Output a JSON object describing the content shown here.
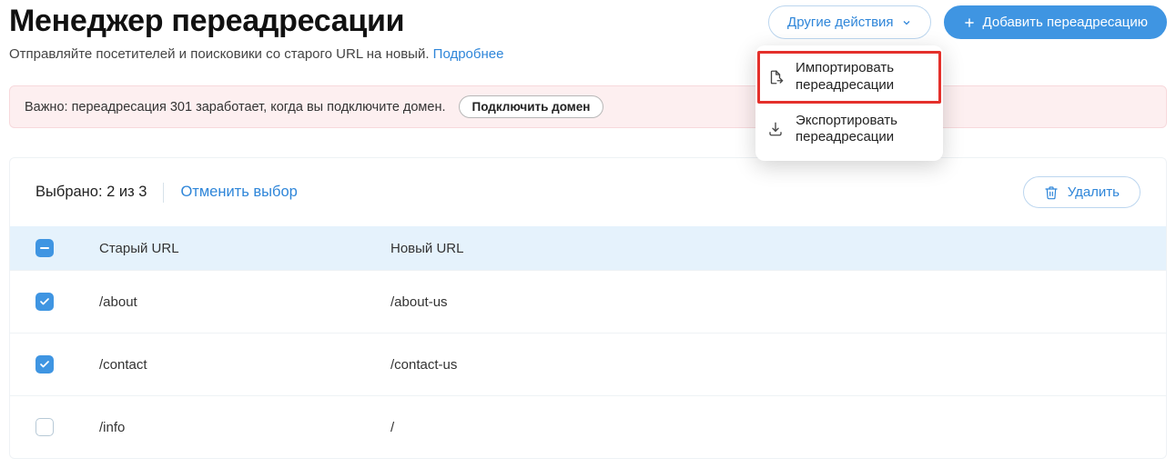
{
  "header": {
    "title": "Менеджер переадресации",
    "subtitle_text": "Отправляйте посетителей и поисковики со старого URL на новый. ",
    "subtitle_link": "Подробнее",
    "more_actions_label": "Другие действия",
    "add_redirect_label": "Добавить переадресацию"
  },
  "dropdown": {
    "import_label": "Импортировать переадресации",
    "export_label": "Экспортировать переадресации"
  },
  "alert": {
    "text": "Важно: переадресация 301 заработает, когда вы подключите домен.",
    "button": "Подключить домен"
  },
  "selection": {
    "count_label": "Выбрано: 2 из 3",
    "cancel_label": "Отменить выбор",
    "delete_label": "Удалить"
  },
  "table": {
    "col_old": "Старый URL",
    "col_new": "Новый URL",
    "rows": [
      {
        "checked": true,
        "old": "/about",
        "new": "/about-us"
      },
      {
        "checked": true,
        "old": "/contact",
        "new": "/contact-us"
      },
      {
        "checked": false,
        "old": "/info",
        "new": "/"
      }
    ]
  }
}
